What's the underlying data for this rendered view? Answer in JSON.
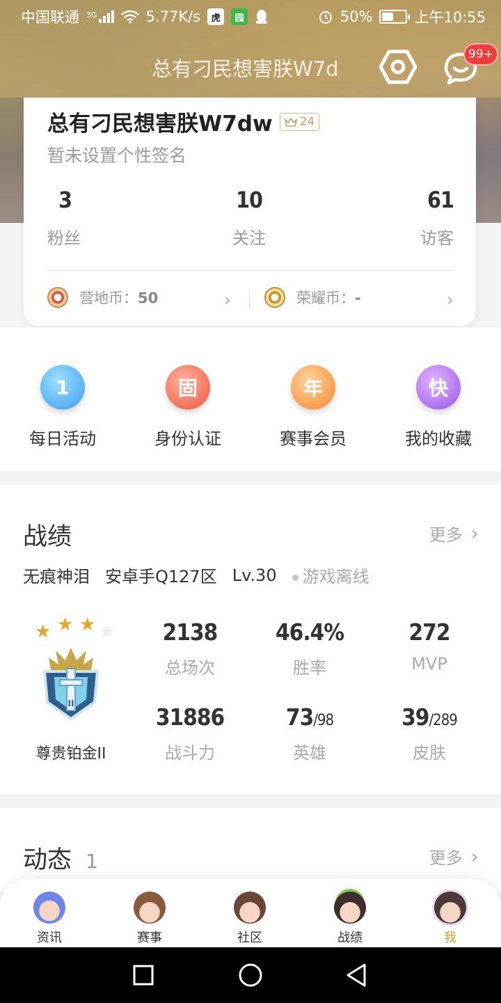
{
  "status_bar": {
    "carrier": "中国联通",
    "network": "3G",
    "speed": "5.77K/s",
    "battery": "50%",
    "time": "上午10:55"
  },
  "header": {
    "title": "总有刁民想害朕W7d",
    "message_badge": "99+"
  },
  "profile": {
    "name": "总有刁民想害朕W7dw",
    "level": "24",
    "signature": "暂未设置个性签名",
    "stats": [
      {
        "value": "3",
        "label": "粉丝"
      },
      {
        "value": "10",
        "label": "关注"
      },
      {
        "value": "61",
        "label": "访客"
      }
    ],
    "coins": [
      {
        "label": "营地币：",
        "value": "50"
      },
      {
        "label": "荣耀币：",
        "value": "-"
      }
    ]
  },
  "quick_menu": [
    {
      "glyph": "1",
      "label": "每日活动",
      "color": "#3a9cf0"
    },
    {
      "glyph": "固",
      "label": "身份认证",
      "color": "#f0543a"
    },
    {
      "glyph": "年",
      "label": "赛事会员",
      "color": "#f5892e"
    },
    {
      "glyph": "快",
      "label": "我的收藏",
      "color": "#9a52e8"
    }
  ],
  "record": {
    "title": "战绩",
    "more": "更多",
    "player_name": "无痕神泪",
    "server": "安卓手Q127区",
    "level": "Lv.30",
    "status": "游戏离线",
    "rank_name": "尊贵铂金II",
    "rank_stars_filled": 3,
    "rank_stars_total": 4,
    "stats": [
      {
        "value": "2138",
        "label": "总场次"
      },
      {
        "value": "46.4%",
        "label": "胜率"
      },
      {
        "value": "272",
        "label": "MVP"
      },
      {
        "value": "31886",
        "label": "战斗力"
      },
      {
        "value": "73",
        "suffix": "/98",
        "label": "英雄"
      },
      {
        "value": "39",
        "suffix": "/289",
        "label": "皮肤"
      }
    ]
  },
  "feed": {
    "title": "动态",
    "count": "1",
    "more": "更多"
  },
  "bottom_nav": [
    {
      "label": "资讯",
      "active": false
    },
    {
      "label": "赛事",
      "active": false
    },
    {
      "label": "社区",
      "active": false
    },
    {
      "label": "战绩",
      "active": false
    },
    {
      "label": "我",
      "active": true
    }
  ],
  "colors": {
    "accent_gold": "#c9a13a",
    "badge_red": "#f23a3a",
    "star_gold": "#e2a821"
  }
}
